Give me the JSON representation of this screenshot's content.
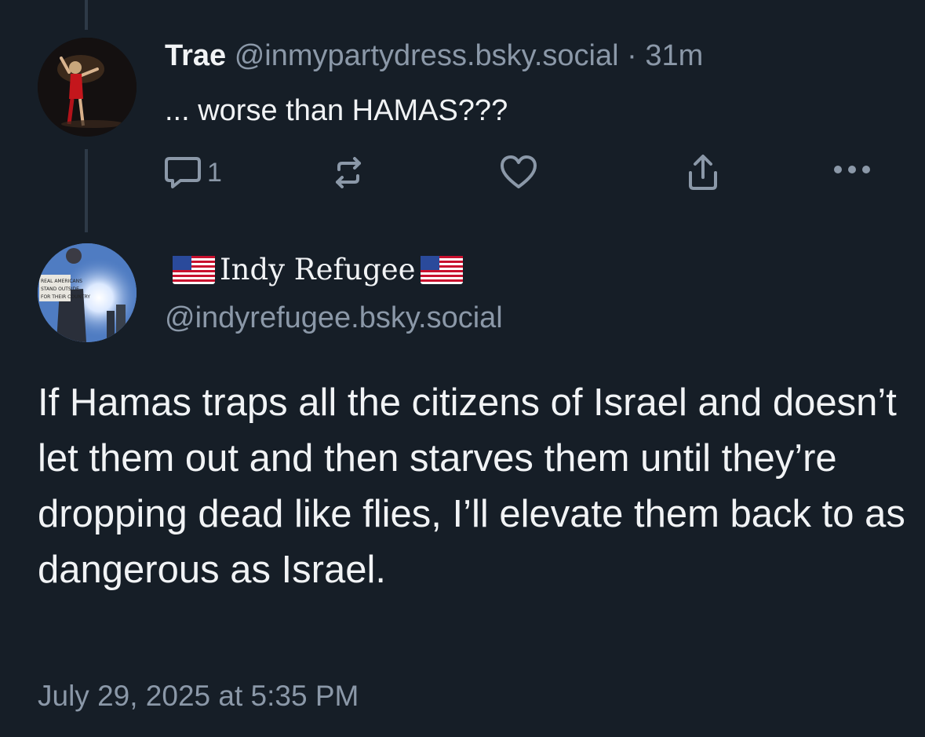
{
  "reply": {
    "author_name": "Trae",
    "author_handle": "@inmypartydress.bsky.social",
    "separator": "·",
    "time_ago": "31m",
    "text": "... worse than HAMAS???",
    "reply_count": "1"
  },
  "post": {
    "author_name": "Indy Refugee",
    "author_handle": "@indyrefugee.bsky.social",
    "body": "If Hamas traps all the citizens of Israel and doesn’t let them out and then starves them until they’re dropping dead like flies, I’ll elevate them back to as dangerous as Israel.",
    "timestamp": "July 29, 2025 at 5:35 PM",
    "avatar_sign_text": "REAL AMERICANS STAND OUTSIDE FOR THEIR COUNTRY"
  },
  "icons": {
    "reply": "reply-bubble-icon",
    "repost": "repost-icon",
    "like": "heart-icon",
    "share": "share-icon",
    "more": "more-dots-icon",
    "flag": "us-flag-emoji"
  },
  "colors": {
    "background": "#161e27",
    "text_primary": "#f1f3f5",
    "text_secondary": "#8b98a8",
    "thread_line": "#2e3a47"
  }
}
